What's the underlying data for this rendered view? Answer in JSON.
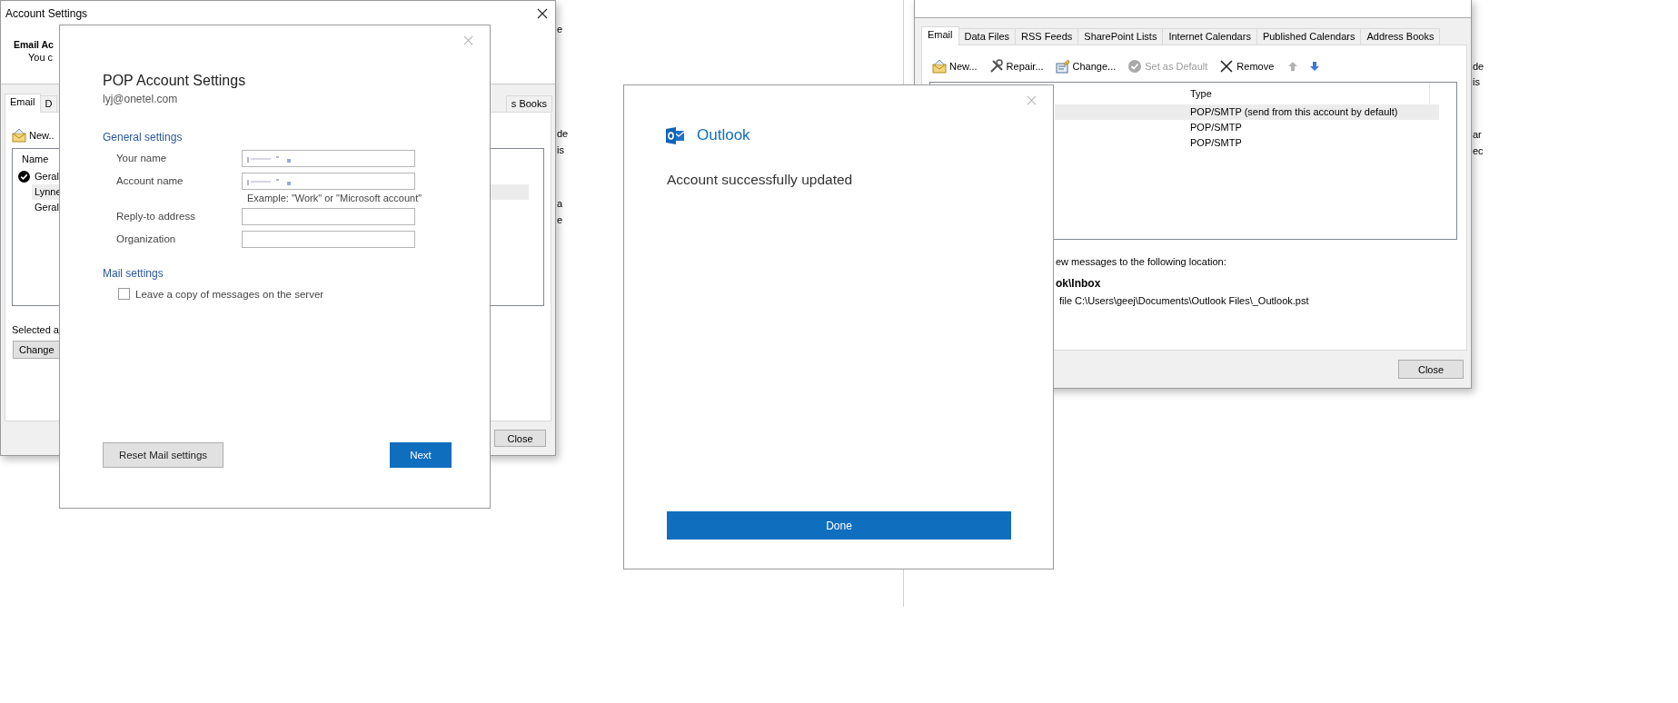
{
  "background_window": {
    "fragments_left": [
      "e",
      "de",
      "is",
      "a",
      "e"
    ],
    "fragments_right": [
      "de",
      "is",
      "ar",
      "ec"
    ]
  },
  "email_accounts_window": {
    "tabs": [
      {
        "label": "Email",
        "selected": true
      },
      {
        "label": "Data Files",
        "selected": false
      },
      {
        "label": "RSS Feeds",
        "selected": false
      },
      {
        "label": "SharePoint Lists",
        "selected": false
      },
      {
        "label": "Internet Calendars",
        "selected": false
      },
      {
        "label": "Published Calendars",
        "selected": false
      },
      {
        "label": "Address Books",
        "selected": false
      }
    ],
    "toolbar": [
      {
        "kind": "new",
        "label": "New...",
        "disabled": false
      },
      {
        "kind": "repair",
        "label": "Repair...",
        "disabled": false
      },
      {
        "kind": "change",
        "label": "Change...",
        "disabled": false
      },
      {
        "kind": "default",
        "label": "Set as Default",
        "disabled": true
      },
      {
        "kind": "remove",
        "label": "Remove",
        "disabled": false
      },
      {
        "kind": "up",
        "disabled": true
      },
      {
        "kind": "down",
        "disabled": false
      }
    ],
    "list": {
      "columns": [
        "Type"
      ],
      "rows": [
        {
          "type": "POP/SMTP (send from this account by default)",
          "selected": true
        },
        {
          "type": "POP/SMTP",
          "selected": false
        },
        {
          "type": "POP/SMTP",
          "selected": false
        }
      ]
    },
    "location_text": "ew messages to the following location:",
    "folder_text": "ok\\Inbox",
    "file_text": "file C:\\Users\\geej\\Documents\\Outlook Files\\_Outlook.pst",
    "close_button": "Close"
  },
  "outlook_dialog": {
    "app_name": "Outlook",
    "message": "Account successfully updated",
    "done_button": "Done"
  },
  "account_settings_window": {
    "title": "Account Settings",
    "header_title": "Email Ac",
    "header_text": "You c",
    "tabs": [
      {
        "label": "Email",
        "selected": true
      },
      {
        "label": "D",
        "selected": false
      },
      {
        "label": "s Books",
        "selected": false
      }
    ],
    "toolbar": [
      {
        "kind": "new",
        "label": "New.."
      }
    ],
    "list": {
      "columns": [
        "Name"
      ],
      "rows": [
        {
          "name": "Geral",
          "default": true,
          "selected": false
        },
        {
          "name": "Lynne",
          "default": false,
          "selected": true
        },
        {
          "name": "Geral",
          "default": false,
          "selected": false
        }
      ]
    },
    "selected_label": "Selected a",
    "change_button": "Change",
    "close_button": "Close"
  },
  "pop_dialog": {
    "title": "POP Account Settings",
    "email": "lyj@onetel.com",
    "general_heading": "General settings",
    "fields": [
      {
        "label": "Your name",
        "redacted": true
      },
      {
        "label": "Account name",
        "redacted": true,
        "hint": "Example: \"Work\" or \"Microsoft account\""
      },
      {
        "label": "Reply-to address",
        "redacted": false
      },
      {
        "label": "Organization",
        "redacted": false
      }
    ],
    "mail_heading": "Mail settings",
    "checkbox": {
      "label": "Leave a copy of messages on the server",
      "checked": false
    },
    "reset_button": "Reset Mail settings",
    "next_button": "Next"
  }
}
